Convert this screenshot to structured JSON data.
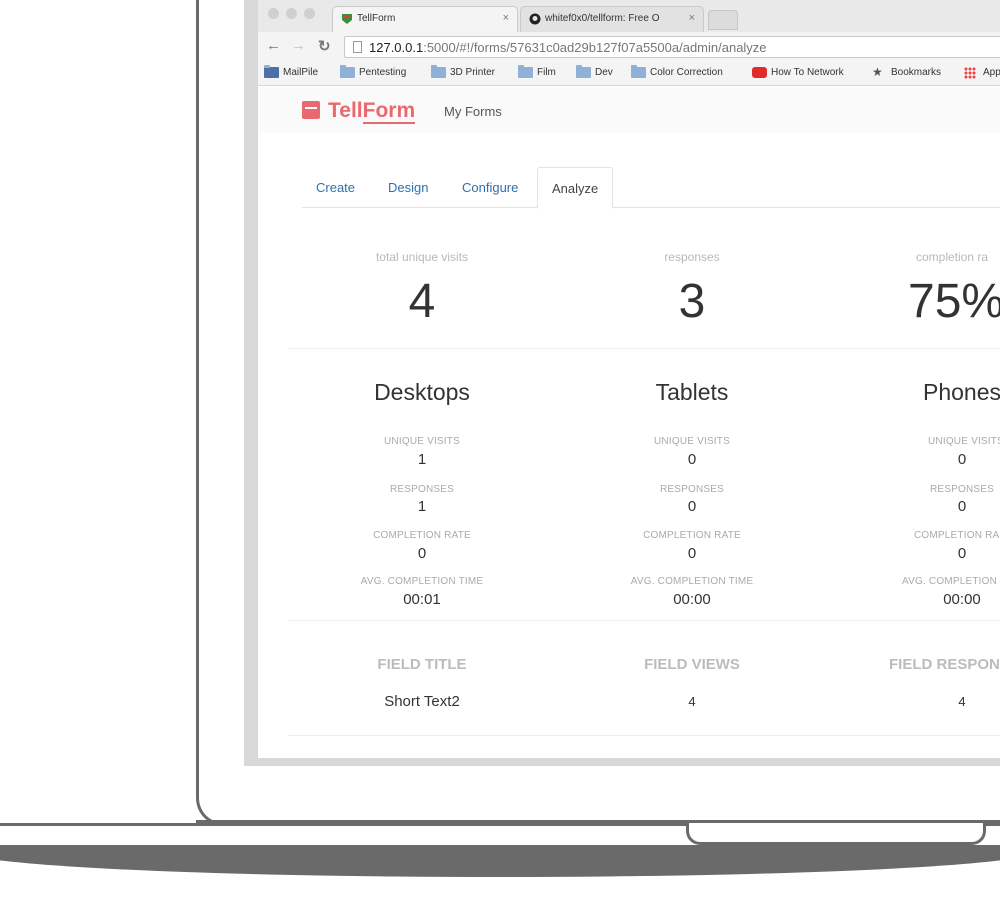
{
  "browser": {
    "tabs": [
      {
        "title": "TellForm",
        "close": "×"
      },
      {
        "title": "whitef0x0/tellform: Free O",
        "close": "×"
      }
    ],
    "url": {
      "host": "127.0.0.1",
      "path": ":5000/#!/forms/57631c0ad29b127f07a5500a/admin/analyze"
    },
    "bookmarks": [
      {
        "label": "MailPile",
        "icon": "mail-icon"
      },
      {
        "label": "Pentesting",
        "icon": "folder-icon"
      },
      {
        "label": "3D Printer",
        "icon": "folder-icon"
      },
      {
        "label": "Film",
        "icon": "folder-icon"
      },
      {
        "label": "Dev",
        "icon": "folder-icon"
      },
      {
        "label": "Color Correction",
        "icon": "folder-icon"
      },
      {
        "label": "How To Network",
        "icon": "youtube-icon"
      },
      {
        "label": "Bookmarks",
        "icon": "star-icon"
      },
      {
        "label": "App",
        "icon": "apps-icon"
      }
    ]
  },
  "app": {
    "logo_prefix": "Tell",
    "logo_suffix": "Form",
    "nav_myforms": "My Forms",
    "brand_color": "#e86a70"
  },
  "form_tabs": [
    "Create",
    "Design",
    "Configure",
    "Analyze"
  ],
  "summary": [
    {
      "label": "total unique visits",
      "value": "4"
    },
    {
      "label": "responses",
      "value": "3"
    },
    {
      "label": "completion ra",
      "value": "75%"
    }
  ],
  "devices": [
    {
      "title": "Desktops",
      "unique_visits": "1",
      "responses": "1",
      "completion_rate": "0",
      "avg_time": "00:01",
      "labels": {
        "uv": "UNIQUE VISITS",
        "resp": "RESPONSES",
        "cr": "COMPLETION RATE",
        "avg": "AVG. COMPLETION TIME"
      }
    },
    {
      "title": "Tablets",
      "unique_visits": "0",
      "responses": "0",
      "completion_rate": "0",
      "avg_time": "00:00",
      "labels": {
        "uv": "UNIQUE VISITS",
        "resp": "RESPONSES",
        "cr": "COMPLETION RATE",
        "avg": "AVG. COMPLETION TIME"
      }
    },
    {
      "title": "Phones",
      "unique_visits": "0",
      "responses": "0",
      "completion_rate": "0",
      "avg_time": "00:00",
      "labels": {
        "uv": "UNIQUE VISITS",
        "resp": "RESPONSES",
        "cr": "COMPLETION RA",
        "avg": "AVG. COMPLETION"
      }
    }
  ],
  "field_table": {
    "headers": [
      "FIELD TITLE",
      "FIELD VIEWS",
      "FIELD RESPON"
    ],
    "rows": [
      [
        "Short Text2",
        "4",
        "4"
      ]
    ]
  }
}
